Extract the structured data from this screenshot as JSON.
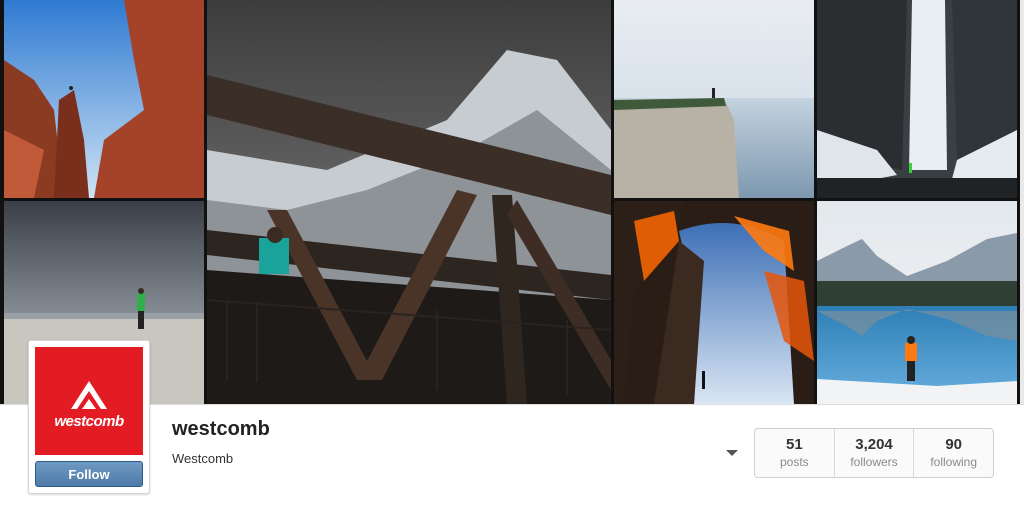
{
  "photos": [
    {
      "id": "red-canyon-hiker",
      "alt": "canyon"
    },
    {
      "id": "beach-hiker-storm",
      "alt": "beach"
    },
    {
      "id": "bridge-mountain",
      "alt": "bridge"
    },
    {
      "id": "sea-cliff",
      "alt": "cliff"
    },
    {
      "id": "waterfall",
      "alt": "waterfall"
    },
    {
      "id": "rock-arch",
      "alt": "arch"
    },
    {
      "id": "lake-reflection",
      "alt": "lake"
    }
  ],
  "profile": {
    "username": "westcomb",
    "full_name": "Westcomb",
    "logo_text": "westcomb",
    "follow_label": "Follow",
    "brand_color": "#e31b23"
  },
  "stats": [
    {
      "value": "51",
      "label": "posts"
    },
    {
      "value": "3,204",
      "label": "followers"
    },
    {
      "value": "90",
      "label": "following"
    }
  ]
}
